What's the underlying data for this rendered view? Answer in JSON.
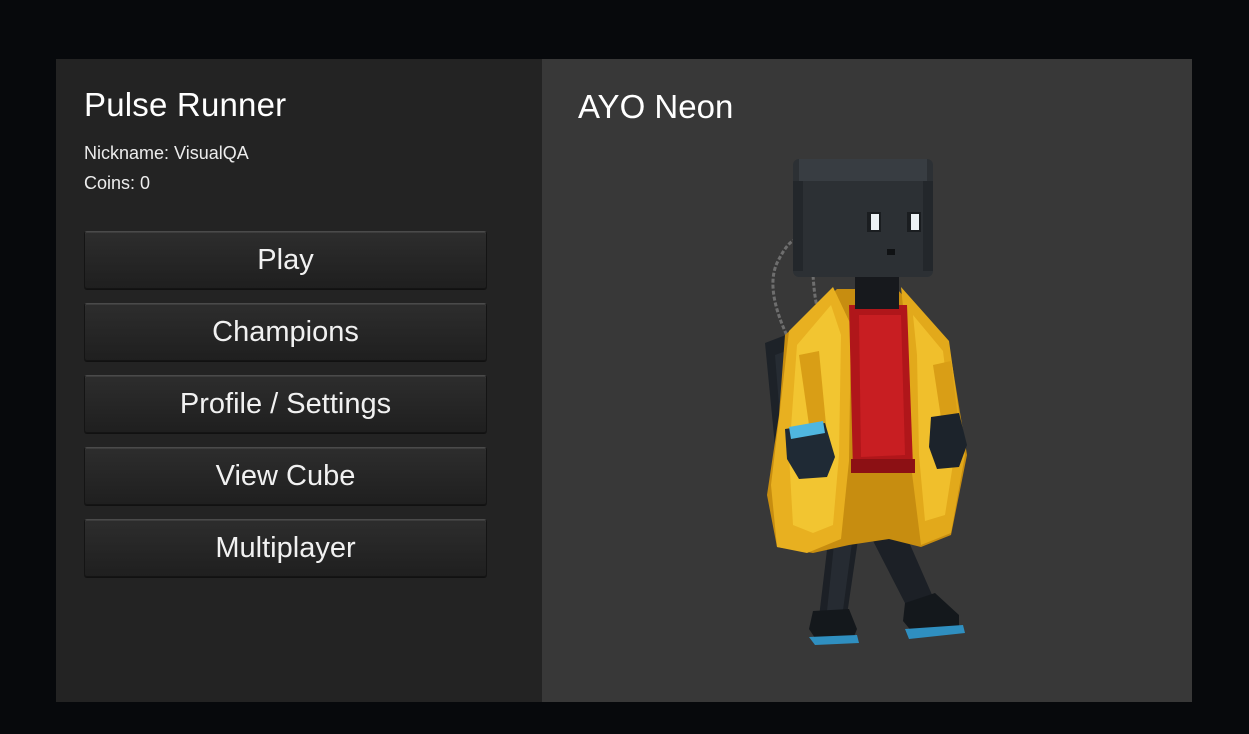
{
  "menu": {
    "title": "Pulse Runner",
    "nickname": "Nickname: VisualQA",
    "coins": "Coins: 0",
    "buttons": [
      "Play",
      "Champions",
      "Profile / Settings",
      "View Cube",
      "Multiplayer"
    ]
  },
  "preview": {
    "champion_name": "AYO Neon",
    "character_icon": "champion-sprite"
  },
  "colors": {
    "background": "#07090c",
    "left_panel": "#232323",
    "right_panel": "#383838",
    "coat": "#e8b020",
    "sweater": "#b0161a"
  }
}
